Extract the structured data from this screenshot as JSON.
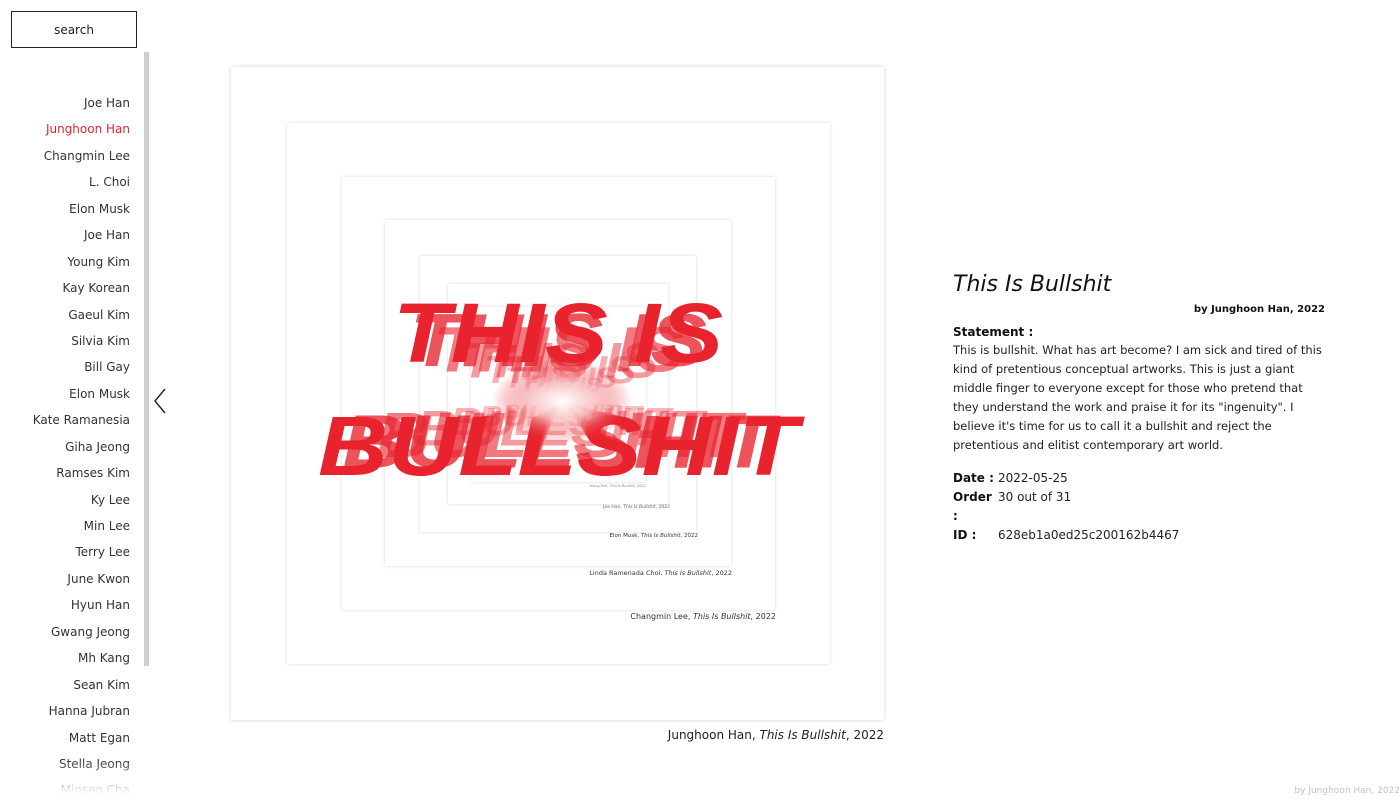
{
  "search": {
    "label": "search"
  },
  "sidebar": {
    "artists": [
      "Joe Han",
      "Junghoon Han",
      "Changmin Lee",
      "L. Choi",
      "Elon Musk",
      "Joe Han",
      "Young Kim",
      "Kay Korean",
      "Gaeul Kim",
      "Silvia Kim",
      "Bill Gay",
      "Elon Musk",
      "Kate Ramanesia",
      "Giha Jeong",
      "Ramses Kim",
      "Ky Lee",
      "Min Lee",
      "Terry Lee",
      "June Kwon",
      "Hyun Han",
      "Gwang Jeong",
      "Mh Kang",
      "Sean Kim",
      "Hanna Jubran",
      "Matt Egan",
      "Stella Jeong",
      "Minseo Cha"
    ],
    "active_index": 1
  },
  "artwork": {
    "headline_line1": "THIS IS",
    "headline_line2": "BULLSHIT",
    "accent_color": "#e8232e",
    "nested_captions": {
      "level1": {
        "artist": "Changmin Lee, ",
        "title": "This Is Bullshit",
        "year": ", 2022"
      },
      "level2": {
        "artist": "Linda Ramenada Choi, ",
        "title": "This Is Bullshit",
        "year": ", 2022"
      },
      "level3": {
        "artist": "Elon Musk, ",
        "title": "This Is Bullshit",
        "year": ", 2022"
      },
      "level4": {
        "artist": "Joe Han, ",
        "title": "This Is Bullshit",
        "year": ", 2022"
      },
      "level5": {
        "artist": "Young Kim, ",
        "title": "This Is Bullshit",
        "year": ", 2022"
      }
    },
    "caption": {
      "artist": "Junghoon Han, ",
      "title": "This Is Bullshit",
      "year": ", 2022"
    }
  },
  "details": {
    "title": "This Is Bullshit",
    "byline": "by Junghoon Han, 2022",
    "statement_label": "Statement :",
    "statement": "This is bullshit. What has art become? I am sick and tired of this kind of pretentious conceptual artworks. This is just a giant middle finger to everyone except for those who pretend that they understand the work and praise it for its \"ingenuity\". I believe it's time for us to call it a bullshit and reject the pretentious and elitist contemporary art world.",
    "date_label": "Date :",
    "date": "2022-05-25",
    "order_label": "Order :",
    "order": "30 out of 31",
    "id_label": "ID :",
    "id": "628eb1a0ed25c200162b4467"
  },
  "footer": {
    "credit": "by Junghoon Han, 2022"
  }
}
